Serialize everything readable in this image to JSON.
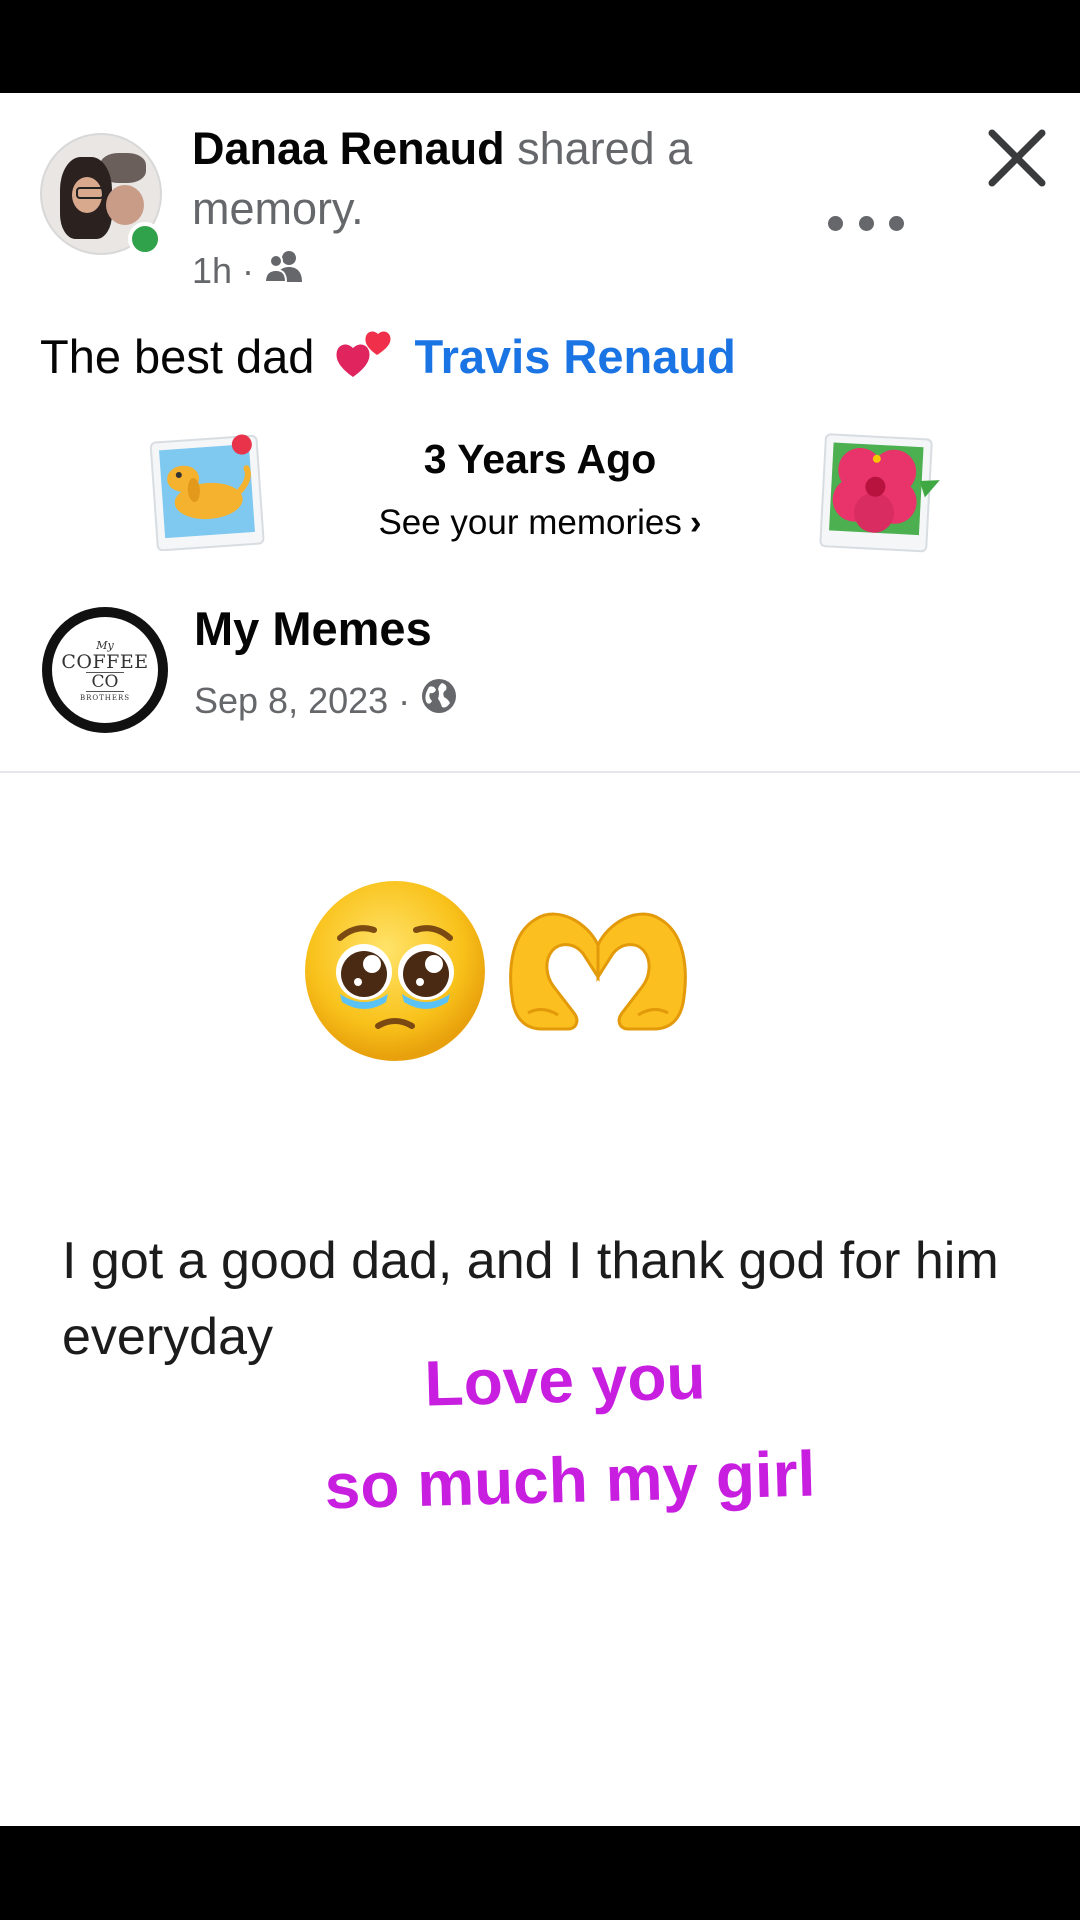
{
  "post": {
    "author": "Danaa Renaud",
    "action": "shared a memory.",
    "time": "1h",
    "separator": "·",
    "audience_icon": "friends-icon",
    "text": "The best dad",
    "emoji": "two-hearts",
    "tagged_name": "Travis Renaud"
  },
  "memories": {
    "title": "3 Years Ago",
    "link": "See your memories",
    "chevron": "›"
  },
  "shared_post": {
    "page_name": "My Memes",
    "date": "Sep 8, 2023",
    "separator": "·",
    "audience_icon": "globe-icon",
    "logo": {
      "line1": "My",
      "line2": "COFFEE",
      "line3": "CO",
      "line4": "BROTHERS"
    },
    "quote": "I got a good dad, and I thank god for him everyday",
    "overlay_line1": "Love you",
    "overlay_line2": "so much my girl"
  },
  "colors": {
    "accent_blue": "#1b74e4",
    "online_green": "#31a24c",
    "overlay_purple": "#c81ee0",
    "secondary_text": "#65676b"
  }
}
